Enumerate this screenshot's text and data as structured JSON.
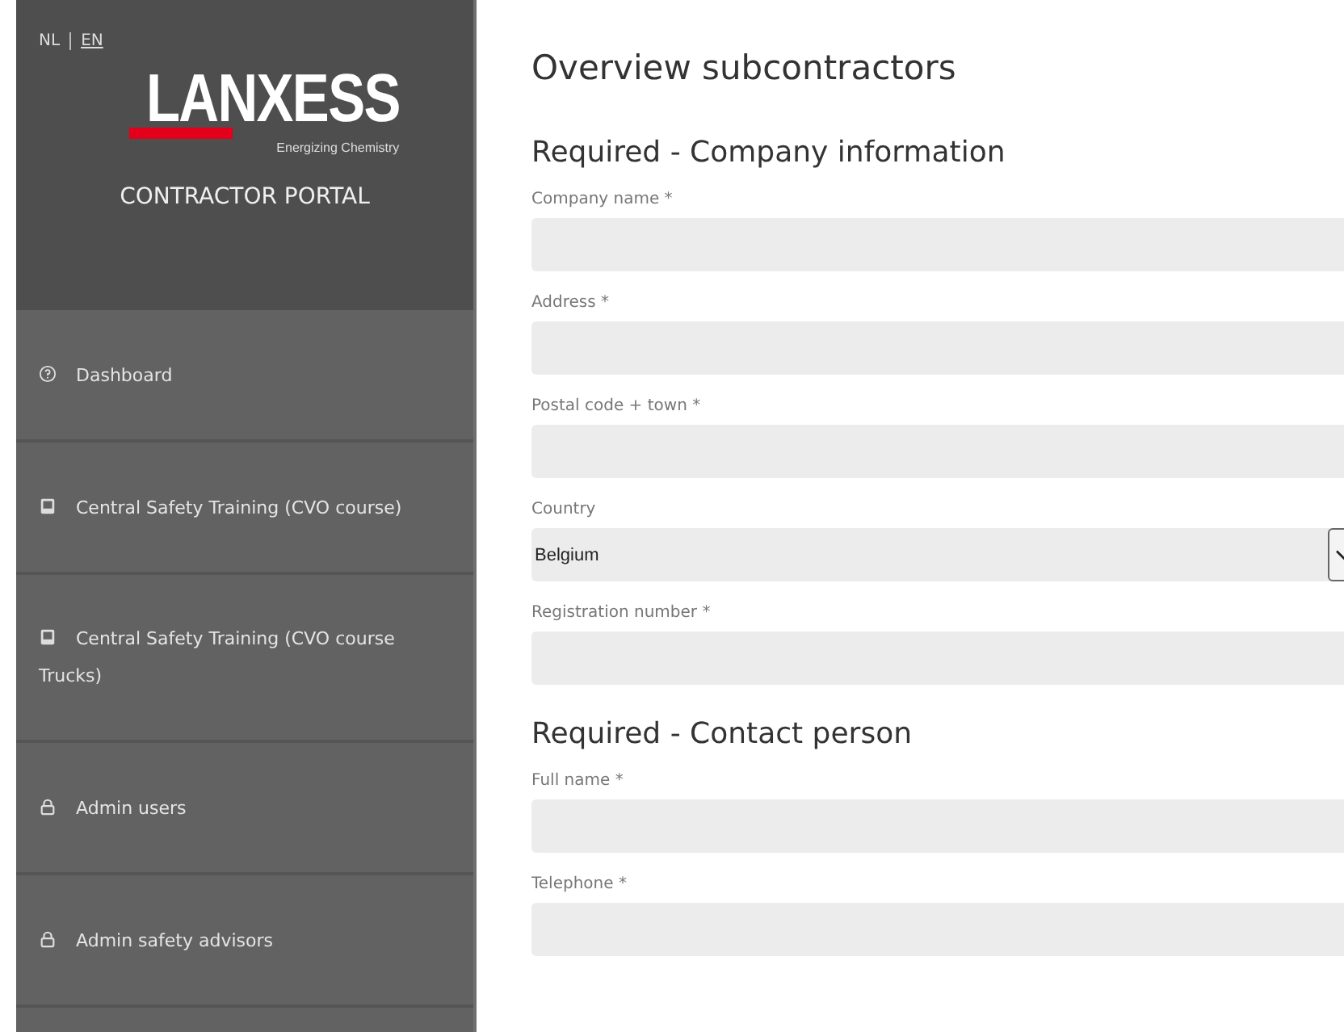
{
  "languages": [
    {
      "label": "NL",
      "selected": false
    },
    {
      "label": "EN",
      "selected": true
    }
  ],
  "logo": {
    "wordmark": "LANXESS",
    "tagline": "Energizing Chemistry"
  },
  "portal_title": "CONTRACTOR PORTAL",
  "sidebar": {
    "items": [
      {
        "label": "Dashboard",
        "kind": "help"
      },
      {
        "label": "Central Safety Training (CVO course)",
        "kind": "course"
      },
      {
        "label": "Central Safety Training (CVO course Trucks)",
        "kind": "course"
      },
      {
        "label": "Admin users",
        "kind": "admin"
      },
      {
        "label": "Admin safety advisors",
        "kind": "admin"
      }
    ]
  },
  "page_title": "Overview subcontractors",
  "sections": [
    {
      "heading": "Required - Company information",
      "fields": [
        {
          "kind": "text",
          "label": "Company name *"
        },
        {
          "kind": "text",
          "label": "Address *"
        },
        {
          "kind": "text",
          "label": "Postal code + town *"
        },
        {
          "kind": "select",
          "label": "Country",
          "value": "Belgium"
        },
        {
          "kind": "text",
          "label": "Registration number *"
        }
      ]
    },
    {
      "heading": "Required - Contact person",
      "fields": [
        {
          "kind": "text",
          "label": "Full name *"
        },
        {
          "kind": "text",
          "label": "Telephone *"
        }
      ]
    }
  ]
}
